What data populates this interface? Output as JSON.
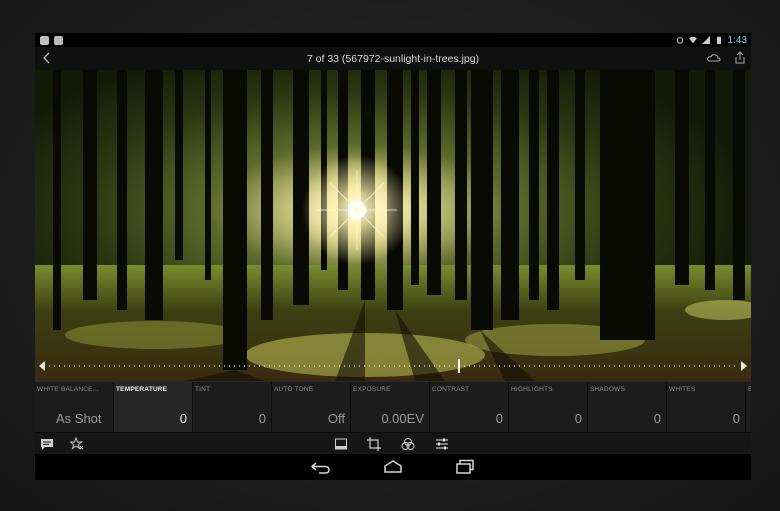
{
  "status_bar": {
    "time": "1:43"
  },
  "header": {
    "title": "7 of 33 (567972-sunlight-in-trees.jpg)"
  },
  "slider": {
    "name": "white-balance-temperature"
  },
  "adjustments": [
    {
      "label": "WHITE BALANCE...",
      "value": "As Shot",
      "active": false
    },
    {
      "label": "TEMPERATURE",
      "value": "0",
      "active": true
    },
    {
      "label": "TINT",
      "value": "0",
      "active": false
    },
    {
      "label": "AUTO TONE",
      "value": "Off",
      "active": false
    },
    {
      "label": "EXPOSURE",
      "value": "0.00EV",
      "active": false
    },
    {
      "label": "CONTRAST",
      "value": "0",
      "active": false
    },
    {
      "label": "HIGHLIGHTS",
      "value": "0",
      "active": false
    },
    {
      "label": "SHADOWS",
      "value": "0",
      "active": false
    },
    {
      "label": "WHITES",
      "value": "0",
      "active": false
    },
    {
      "label": "B",
      "value": "",
      "active": false
    }
  ],
  "toolbar": {
    "left_icons": [
      "comment-icon",
      "star-flag-icon"
    ],
    "center_icons": [
      "crop-presets-icon",
      "crop-icon",
      "color-mix-icon",
      "adjust-sliders-icon"
    ]
  },
  "colors": {
    "accent_time": "#7fd4f5",
    "panel": "#191919",
    "active_tile": "#262626"
  }
}
